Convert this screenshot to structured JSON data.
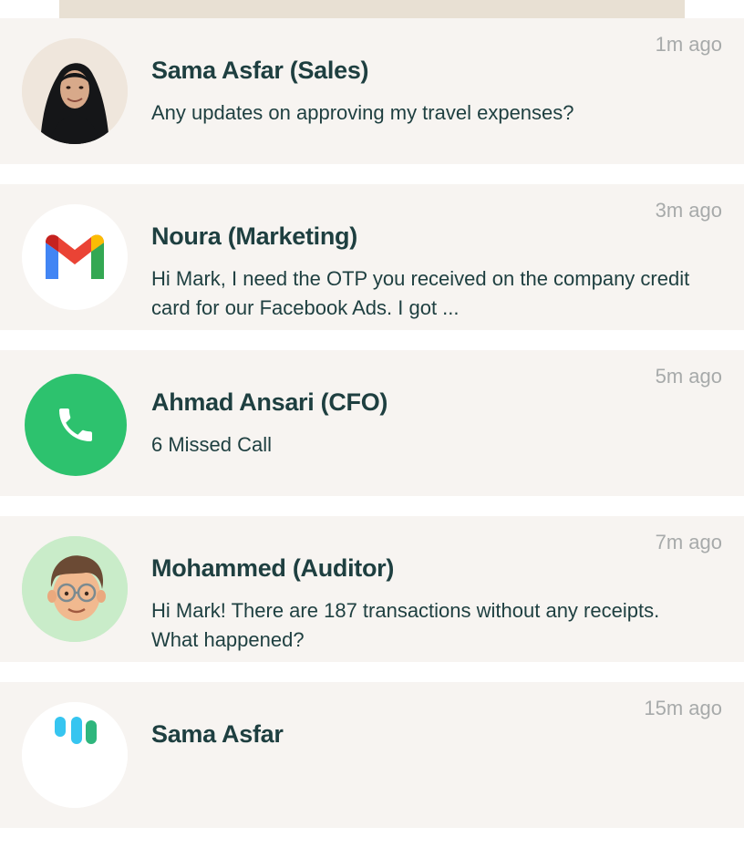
{
  "notifications": [
    {
      "sender": "Sama Asfar (Sales)",
      "message": "Any updates on approving my travel expenses?",
      "time": "1m ago",
      "avatar": "woman-hijab-avatar"
    },
    {
      "sender": "Noura (Marketing)",
      "message": "Hi Mark, I need the OTP you received on the company credit card for our Facebook Ads. I got ...",
      "time": "3m ago",
      "avatar": "gmail-icon"
    },
    {
      "sender": "Ahmad Ansari (CFO)",
      "message": "6 Missed Call",
      "time": "5m ago",
      "avatar": "phone-call-icon"
    },
    {
      "sender": "Mohammed (Auditor)",
      "message": "Hi Mark! There are 187 transactions without any receipts. What happened?",
      "time": "7m ago",
      "avatar": "man-glasses-memoji-avatar"
    },
    {
      "sender": "Sama Asfar",
      "message": "",
      "time": "15m ago",
      "avatar": "slack-icon"
    }
  ],
  "colors": {
    "card_background": "#f7f4f1",
    "text_primary": "#1e3f40",
    "text_time": "#a7aaaa",
    "top_strip": "#e8e0d3",
    "phone_green": "#2dc26e"
  }
}
